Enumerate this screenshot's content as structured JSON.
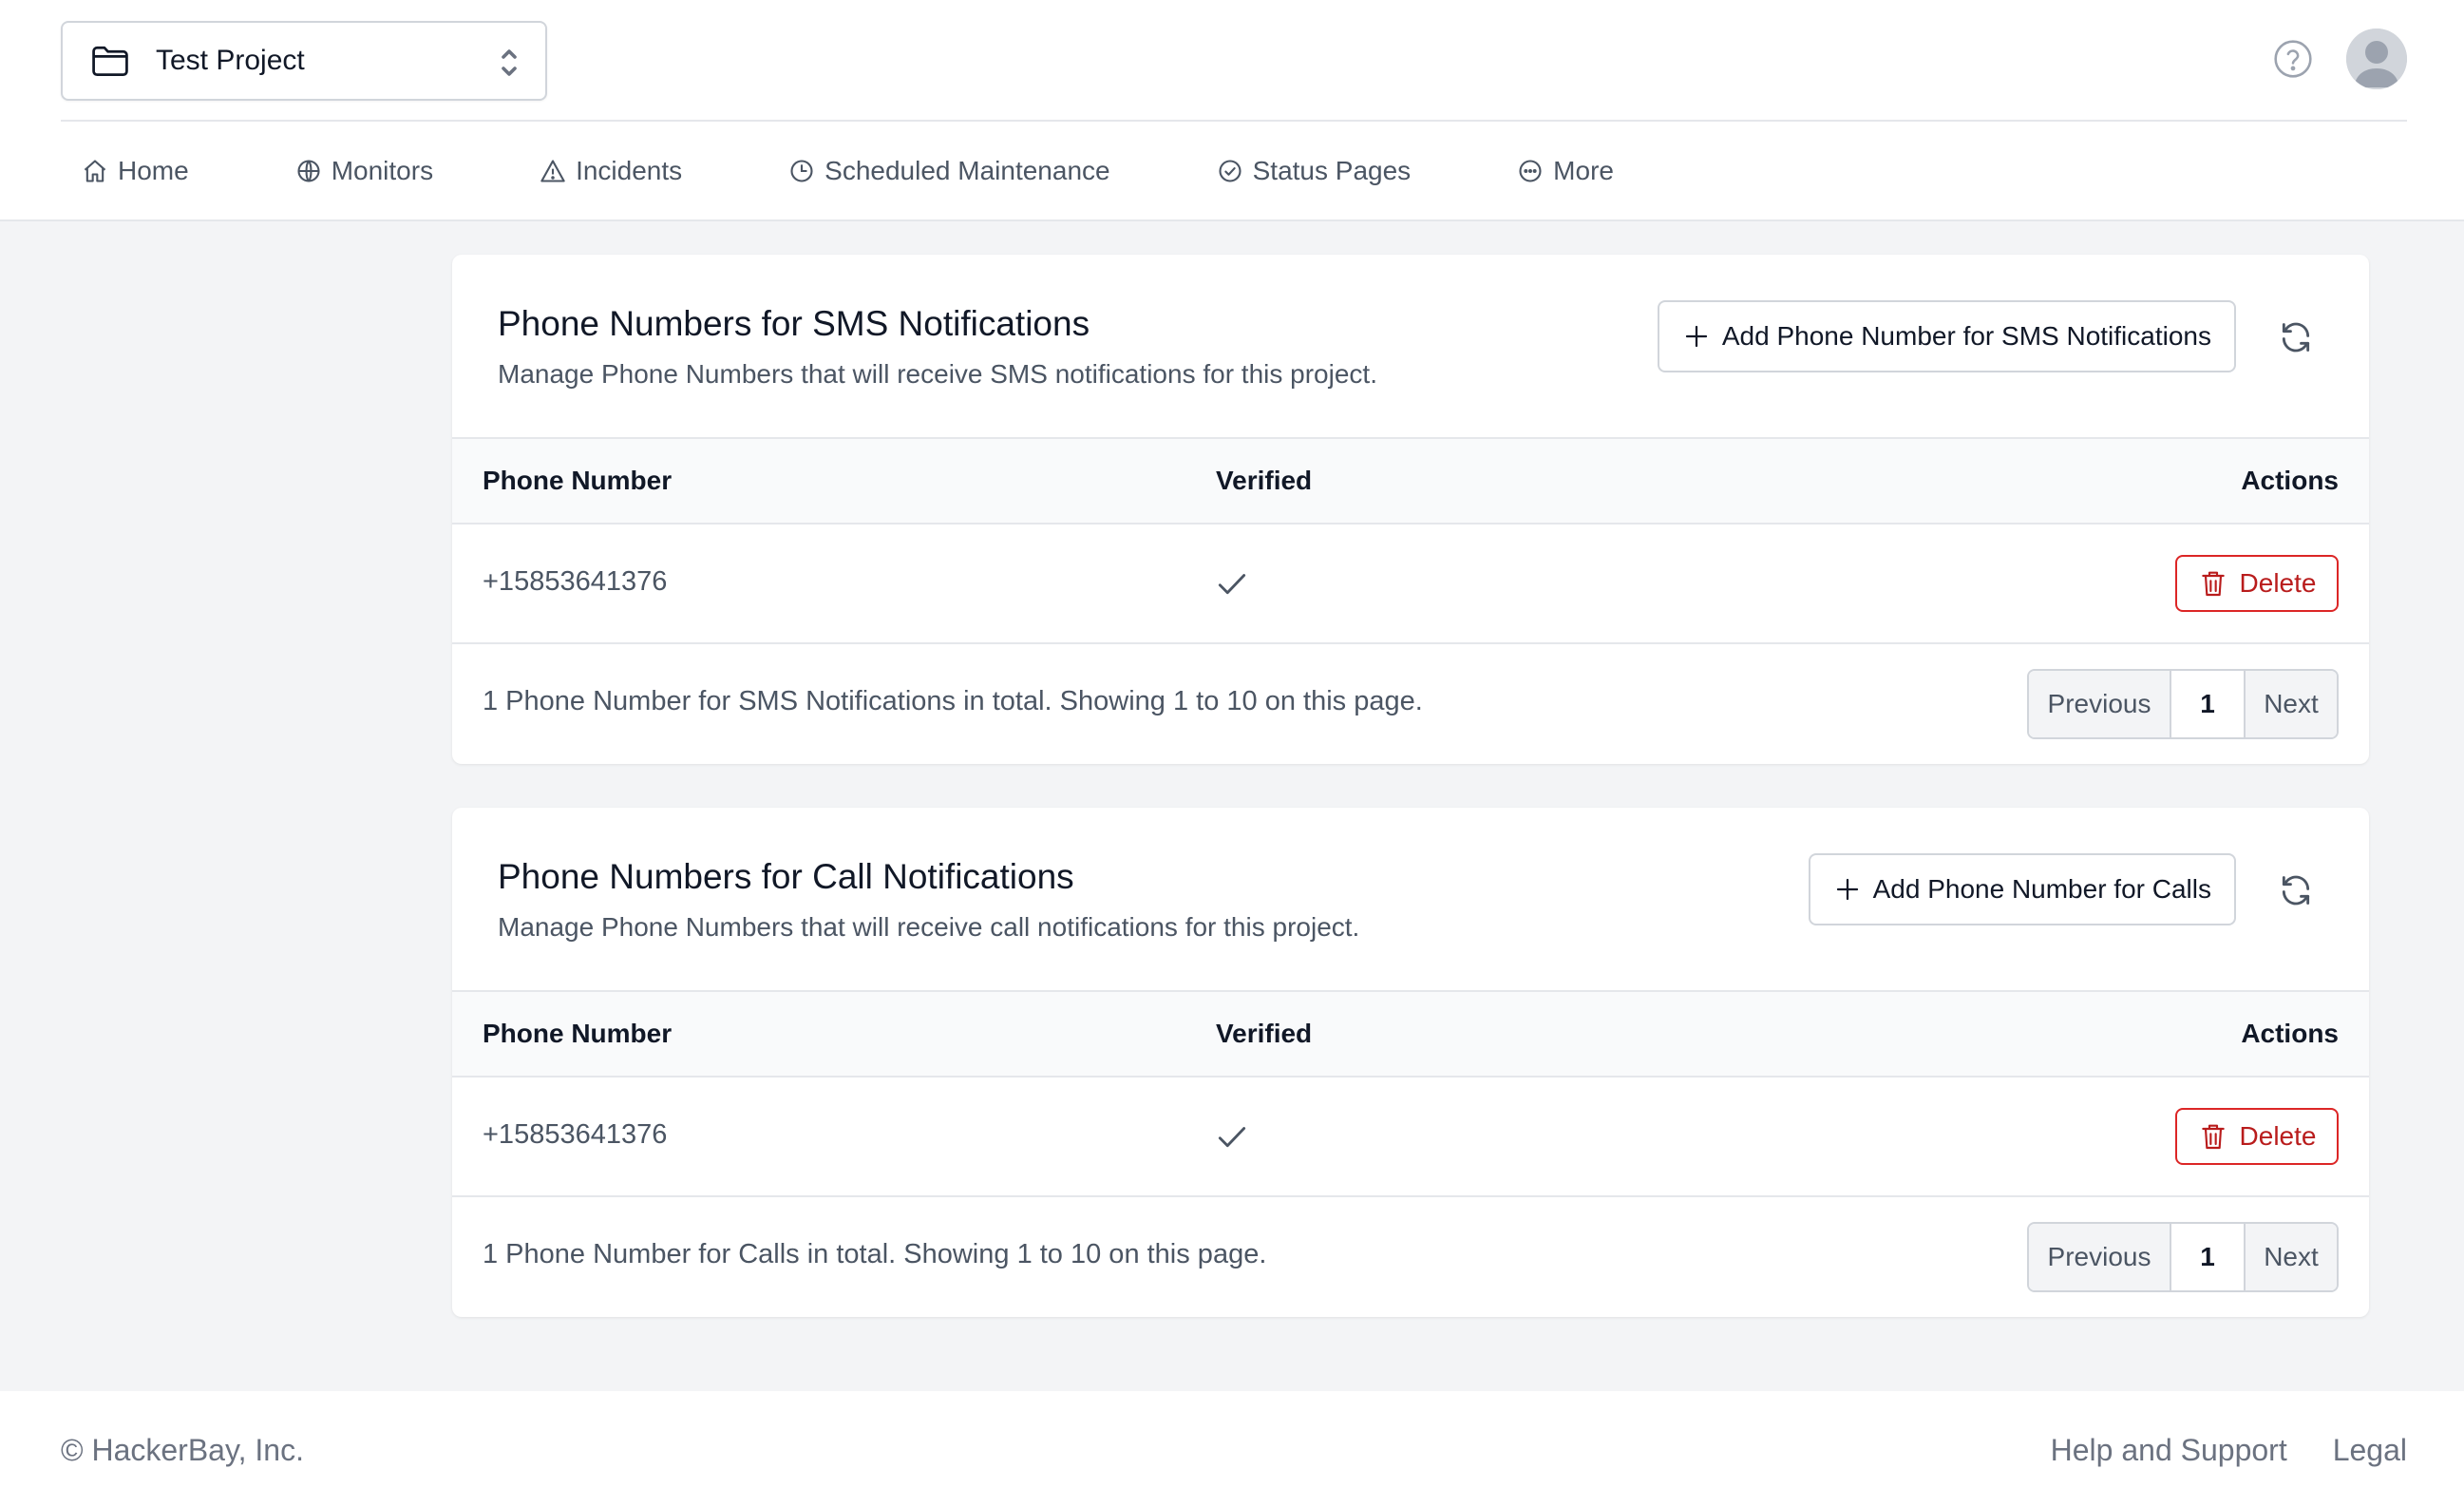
{
  "header": {
    "project_name": "Test Project",
    "help_icon": "question-circle-icon",
    "avatar_icon": "user-avatar-icon"
  },
  "nav": [
    {
      "label": "Home",
      "icon": "home-icon"
    },
    {
      "label": "Monitors",
      "icon": "globe-icon"
    },
    {
      "label": "Incidents",
      "icon": "warning-triangle-icon"
    },
    {
      "label": "Scheduled Maintenance",
      "icon": "clock-icon"
    },
    {
      "label": "Status Pages",
      "icon": "check-circle-icon"
    },
    {
      "label": "More",
      "icon": "ellipsis-circle-icon"
    }
  ],
  "sms": {
    "title": "Phone Numbers for SMS Notifications",
    "description": "Manage Phone Numbers that will receive SMS notifications for this project.",
    "add_label": "Add Phone Number for SMS Notifications",
    "columns": {
      "phone": "Phone Number",
      "verified": "Verified",
      "actions": "Actions"
    },
    "rows": [
      {
        "phone": "+15853641376",
        "verified": true,
        "action": "Delete"
      }
    ],
    "summary": "1 Phone Number for SMS Notifications in total. Showing 1 to 10 on this page.",
    "pager": {
      "prev": "Previous",
      "page": "1",
      "next": "Next"
    }
  },
  "call": {
    "title": "Phone Numbers for Call Notifications",
    "description": "Manage Phone Numbers that will receive call notifications for this project.",
    "add_label": "Add Phone Number for Calls",
    "columns": {
      "phone": "Phone Number",
      "verified": "Verified",
      "actions": "Actions"
    },
    "rows": [
      {
        "phone": "+15853641376",
        "verified": true,
        "action": "Delete"
      }
    ],
    "summary": "1 Phone Number for Calls in total. Showing 1 to 10 on this page.",
    "pager": {
      "prev": "Previous",
      "page": "1",
      "next": "Next"
    }
  },
  "footer": {
    "copyright": "© HackerBay, Inc.",
    "links": [
      "Help and Support",
      "Legal"
    ]
  },
  "colors": {
    "danger": "#dc2626",
    "background": "#f3f4f6",
    "text_muted": "#4b5563"
  }
}
